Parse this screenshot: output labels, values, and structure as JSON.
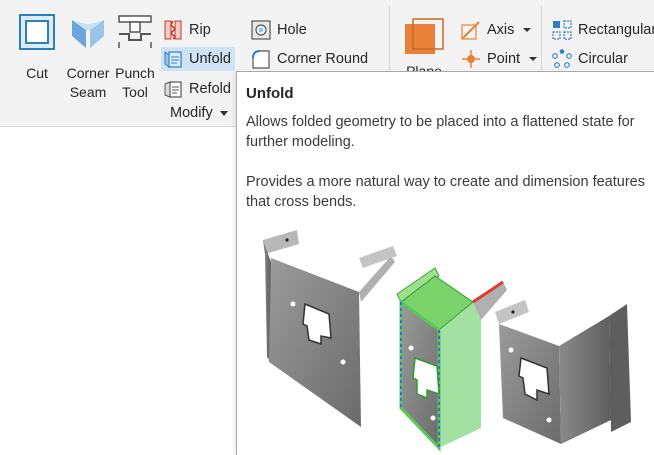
{
  "ribbon": {
    "big_buttons": [
      {
        "id": "cut",
        "label": "Cut"
      },
      {
        "id": "corner-seam",
        "label_line1": "Corner",
        "label_line2": "Seam"
      },
      {
        "id": "punch-tool",
        "label_line1": "Punch",
        "label_line2": "Tool"
      }
    ],
    "modify_column": {
      "rip": "Rip",
      "unfold": "Unfold",
      "refold": "Refold"
    },
    "features_column": {
      "hole": "Hole",
      "corner_round": "Corner Round"
    },
    "modify_group_label": "Modify",
    "plane_label": "Plane",
    "work_features": {
      "axis": "Axis",
      "point": "Point"
    },
    "pattern": {
      "rectangular": "Rectangular",
      "circular": "Circular"
    }
  },
  "tooltip": {
    "title": "Unfold",
    "paragraph1_line1": "Allows folded geometry to be placed into a flattened state for",
    "paragraph1_line2": "further modeling.",
    "paragraph2_line1": "Provides a more natural way to create and dimension features",
    "paragraph2_line2": "that cross bends."
  },
  "colors": {
    "ribbon_bg": "#f3f3f3",
    "active_highlight": "#cfe3f5",
    "plane_orange": "#e8823a",
    "accent_blue": "#2f7ec4",
    "unfold_green": "#58c958",
    "bend_red": "#e03a2a"
  }
}
